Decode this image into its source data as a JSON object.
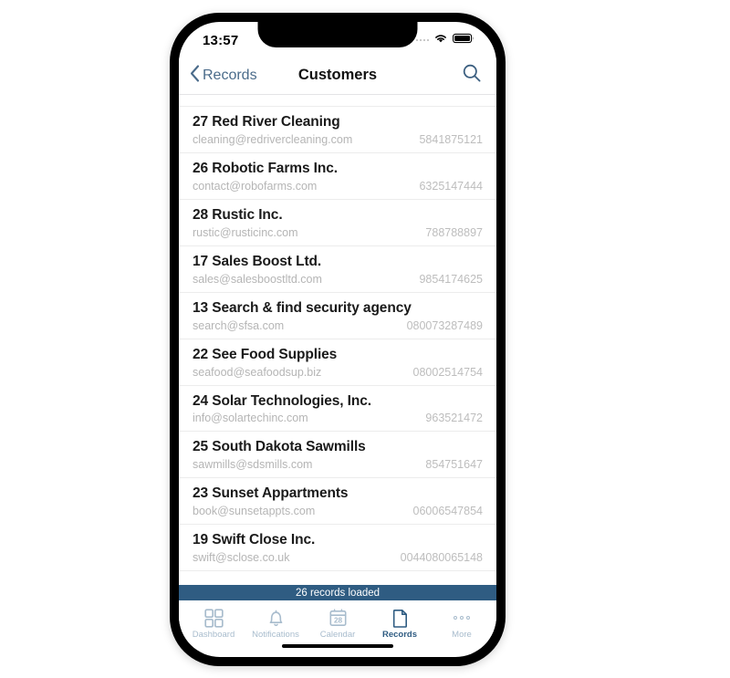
{
  "status_bar": {
    "time": "13:57",
    "signal_icon": "signal-dots-icon",
    "wifi_icon": "wifi-icon",
    "battery_icon": "battery-icon"
  },
  "nav_bar": {
    "back_label": "Records",
    "back_icon": "chevron-left-icon",
    "title": "Customers",
    "search_icon": "search-icon"
  },
  "records": [
    {
      "title": "27 Red River Cleaning",
      "email": "cleaning@redrivercleaning.com",
      "phone": "5841875121"
    },
    {
      "title": "26 Robotic Farms Inc.",
      "email": "contact@robofarms.com",
      "phone": "6325147444"
    },
    {
      "title": "28 Rustic Inc.",
      "email": "rustic@rusticinc.com",
      "phone": "788788897"
    },
    {
      "title": "17 Sales Boost Ltd.",
      "email": "sales@salesboostltd.com",
      "phone": "9854174625"
    },
    {
      "title": "13 Search & find security agency",
      "email": "search@sfsa.com",
      "phone": "080073287489"
    },
    {
      "title": "22 See Food Supplies",
      "email": "seafood@seafoodsup.biz",
      "phone": "08002514754"
    },
    {
      "title": "24 Solar Technologies, Inc.",
      "email": "info@solartechinc.com",
      "phone": "963521472"
    },
    {
      "title": "25 South Dakota Sawmills",
      "email": "sawmills@sdsmills.com",
      "phone": "854751647"
    },
    {
      "title": "23 Sunset Appartments",
      "email": "book@sunsetappts.com",
      "phone": "06006547854"
    },
    {
      "title": "19 Swift Close Inc.",
      "email": "swift@sclose.co.uk",
      "phone": "0044080065148"
    }
  ],
  "status_strip": {
    "text": "26 records loaded",
    "background_color": "#2f5c82"
  },
  "tab_bar": {
    "active_color": "#2f5c82",
    "inactive_color": "#a8bccd",
    "items": [
      {
        "label": "Dashboard",
        "icon": "grid-icon",
        "active": false
      },
      {
        "label": "Notifications",
        "icon": "bell-icon",
        "active": false
      },
      {
        "label": "Calendar",
        "icon": "calendar-icon",
        "active": false,
        "badge": "28"
      },
      {
        "label": "Records",
        "icon": "document-icon",
        "active": true
      },
      {
        "label": "More",
        "icon": "ellipsis-icon",
        "active": false
      }
    ]
  }
}
